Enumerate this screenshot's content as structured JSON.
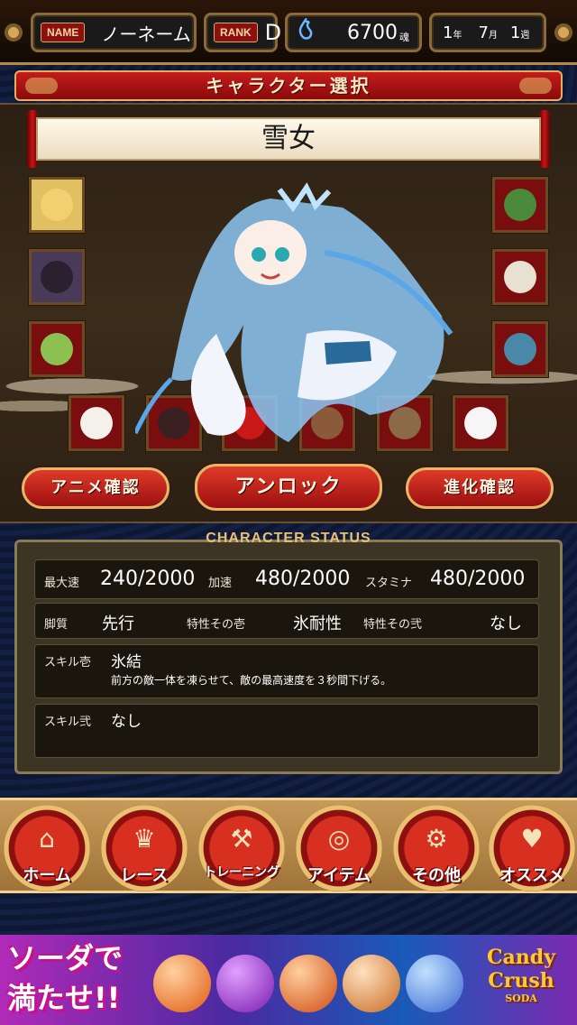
{
  "header": {
    "name_tag": "NAME",
    "name_value": "ノーネーム",
    "rank_tag": "RANK",
    "rank_value": "D",
    "souls_value": "6700",
    "souls_unit": "魂",
    "date": {
      "year": "1",
      "year_unit": "年",
      "month": "7",
      "month_unit": "月",
      "week": "1",
      "week_unit": "週"
    }
  },
  "title_banner": "キャラクター選択",
  "character_name": "雪女",
  "buttons": {
    "anime": "アニメ確認",
    "unlock": "アンロック",
    "evolve": "進化確認"
  },
  "status": {
    "title": "CHARACTER STATUS",
    "max_speed_label": "最大速",
    "max_speed_value": "240/2000",
    "accel_label": "加速",
    "accel_value": "480/2000",
    "stamina_label": "スタミナ",
    "stamina_value": "480/2000",
    "style_label": "脚質",
    "style_value": "先行",
    "trait1_label": "特性その壱",
    "trait1_value": "氷耐性",
    "trait2_label": "特性その弐",
    "trait2_value": "なし",
    "skill1_label": "スキル壱",
    "skill1_name": "氷結",
    "skill1_desc": "前方の敵一体を凍らせて、敵の最高速度を３秒間下げる。",
    "skill2_label": "スキル弐",
    "skill2_name": "なし"
  },
  "nav": {
    "home": "ホーム",
    "race": "レース",
    "training": "トレーニング",
    "item": "アイテム",
    "other": "その他",
    "recommend": "オススメ"
  },
  "ad": {
    "line1": "ソーダで",
    "line2": "満たせ!!",
    "logo_line1": "Candy",
    "logo_line2": "Crush",
    "logo_side": "SODA"
  }
}
